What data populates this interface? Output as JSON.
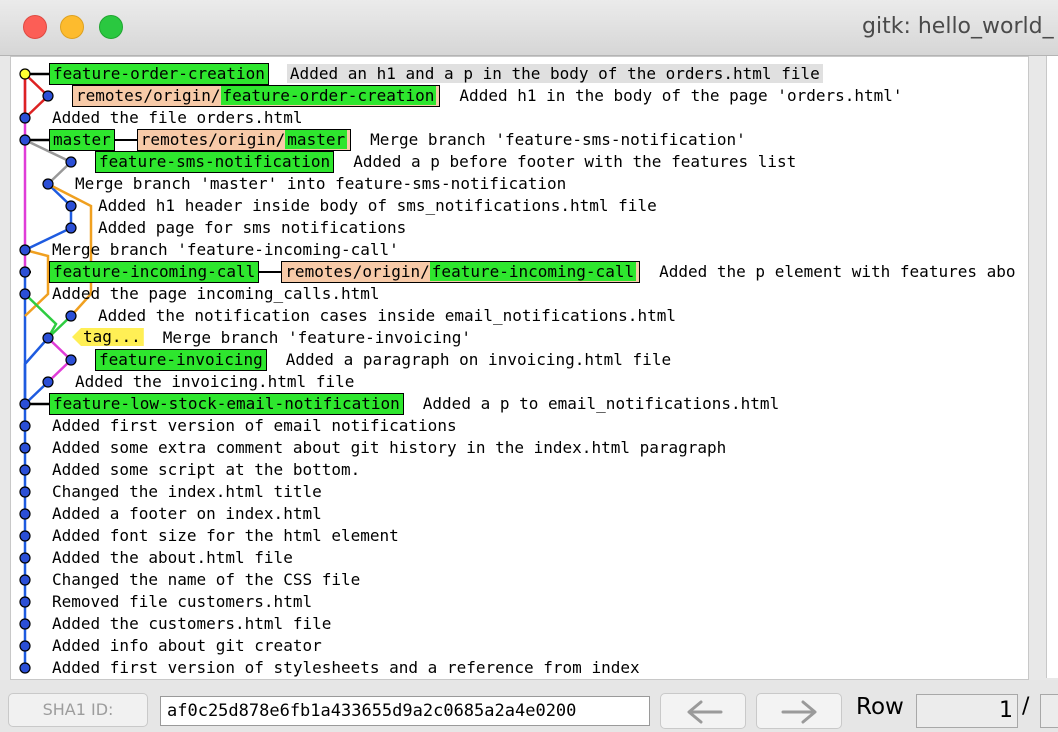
{
  "window": {
    "title": "gitk: hello_world_"
  },
  "colors": {
    "branch_bg": "#2ee62e",
    "remote_bg": "#f7caa8",
    "tag_bg": "#ffef55",
    "head_node": "#ffff33",
    "node": "#2b4fd6",
    "highlight_bg": "#e0e0e0"
  },
  "commits": [
    {
      "subject": "Added an h1 and a p in the body of the orders.html file",
      "highlight": true,
      "refs": [
        {
          "type": "local",
          "name": "feature-order-creation"
        }
      ]
    },
    {
      "subject": "Added h1 in the body of the page 'orders.html'",
      "refs": [
        {
          "type": "remote",
          "prefix": "remotes/origin/",
          "branch": "feature-order-creation"
        }
      ]
    },
    {
      "subject": "Added the file orders.html",
      "refs": []
    },
    {
      "subject": "Merge branch 'feature-sms-notification'",
      "refs": [
        {
          "type": "local",
          "name": "master"
        },
        {
          "type": "remote",
          "prefix": "remotes/origin/",
          "branch": "master"
        }
      ]
    },
    {
      "subject": "Added a p before footer with the features list",
      "refs": [
        {
          "type": "local",
          "name": "feature-sms-notification"
        }
      ]
    },
    {
      "subject": "Merge branch 'master' into feature-sms-notification",
      "refs": []
    },
    {
      "subject": "Added h1 header inside body of sms_notifications.html file",
      "refs": []
    },
    {
      "subject": "Added page for sms notifications",
      "refs": []
    },
    {
      "subject": "Merge branch 'feature-incoming-call'",
      "refs": []
    },
    {
      "subject": "Added the p element with features abo",
      "refs": [
        {
          "type": "local",
          "name": "feature-incoming-call"
        },
        {
          "type": "remote",
          "prefix": "remotes/origin/",
          "branch": "feature-incoming-call"
        }
      ]
    },
    {
      "subject": "Added the page incoming_calls.html",
      "refs": []
    },
    {
      "subject": "Added the notification cases inside email_notifications.html",
      "refs": []
    },
    {
      "subject": "Merge branch 'feature-invoicing'",
      "refs": [
        {
          "type": "tag",
          "name": "tag..."
        }
      ]
    },
    {
      "subject": "Added a paragraph on invoicing.html file",
      "refs": [
        {
          "type": "local",
          "name": "feature-invoicing"
        }
      ]
    },
    {
      "subject": "Added the invoicing.html file",
      "refs": []
    },
    {
      "subject": "Added a p to email_notifications.html",
      "refs": [
        {
          "type": "local",
          "name": "feature-low-stock-email-notification"
        }
      ]
    },
    {
      "subject": "Added first version of email notifications",
      "refs": []
    },
    {
      "subject": "Added some extra comment about git history in the index.html paragraph",
      "refs": []
    },
    {
      "subject": "Added some script at the bottom.",
      "refs": []
    },
    {
      "subject": "Changed the index.html title",
      "refs": []
    },
    {
      "subject": "Added a footer on index.html",
      "refs": []
    },
    {
      "subject": "Added font size for the html element",
      "refs": []
    },
    {
      "subject": "Added the about.html file",
      "refs": []
    },
    {
      "subject": "Changed the name of the CSS file",
      "refs": []
    },
    {
      "subject": "Removed file customers.html",
      "refs": []
    },
    {
      "subject": "Added the customers.html file",
      "refs": []
    },
    {
      "subject": "Added info about git creator",
      "refs": []
    },
    {
      "subject": "Added first version of stylesheets and a reference from index",
      "refs": []
    }
  ],
  "bottom": {
    "sha_label": "SHA1 ID:",
    "sha_value": "af0c25d878e6fb1a433655d9a2c0685a2a4e0200",
    "back_icon": "left-arrow-icon",
    "forward_icon": "right-arrow-icon",
    "row_label": "Row",
    "row_value": "1",
    "row_sep": "/"
  }
}
